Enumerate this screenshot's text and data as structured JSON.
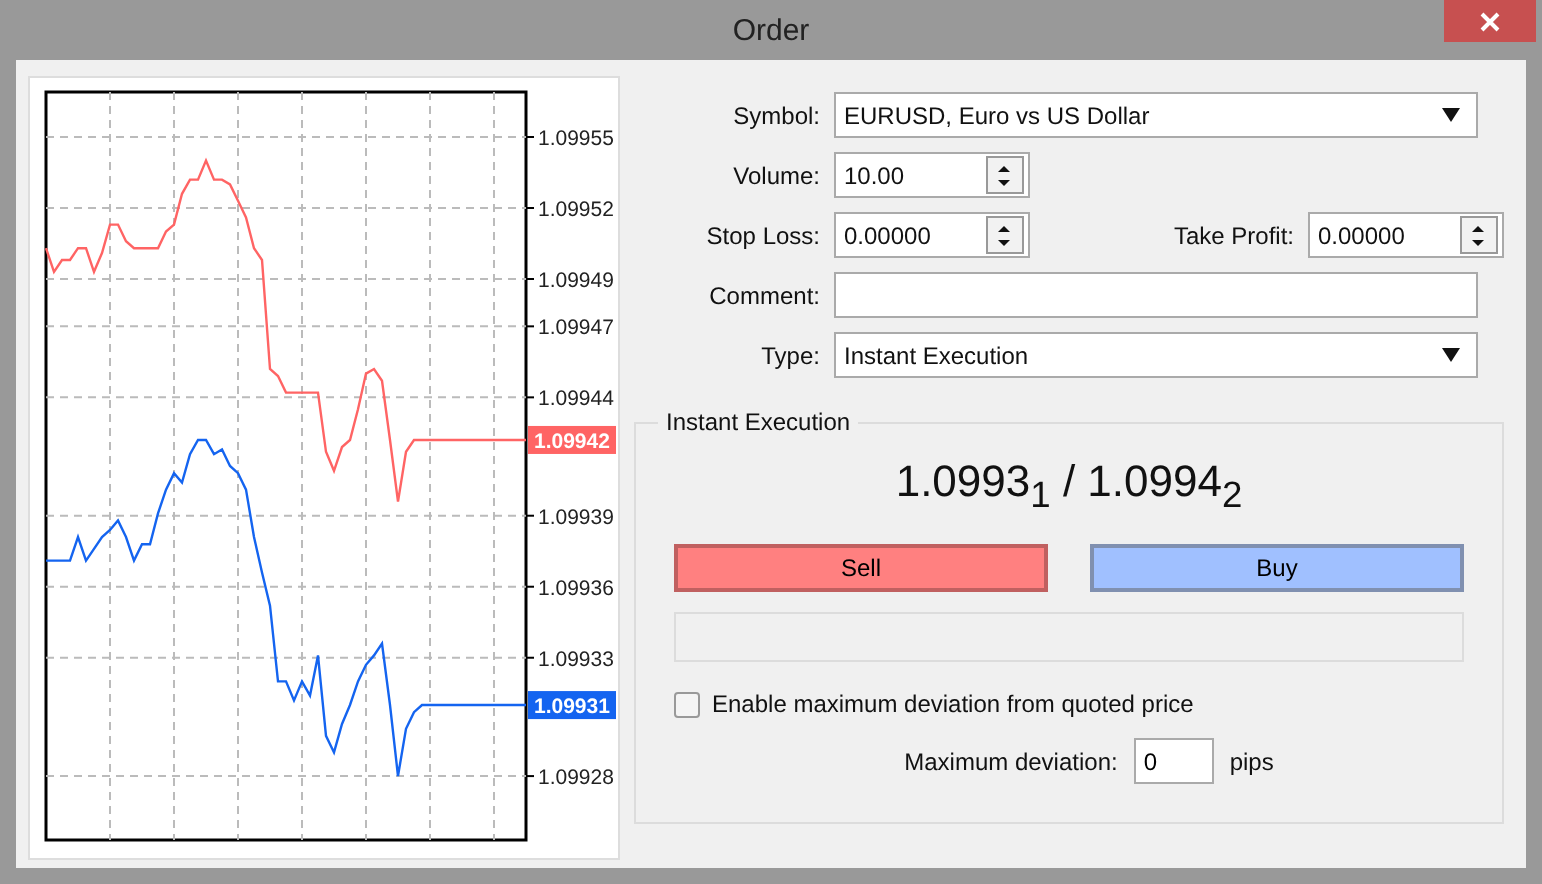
{
  "window": {
    "title": "Order"
  },
  "chart": {
    "chart_data": {
      "type": "line",
      "grid": true,
      "categories": [
        null,
        null,
        null,
        null,
        null,
        null,
        null,
        null,
        null,
        null,
        null,
        null,
        null,
        null,
        null,
        null,
        null,
        null,
        null,
        null,
        null,
        null,
        null,
        null,
        null,
        null,
        null,
        null,
        null,
        null,
        null,
        null,
        null,
        null,
        null,
        null,
        null,
        null,
        null,
        null,
        null,
        null,
        null,
        null,
        null,
        null,
        null,
        null,
        null,
        null,
        null,
        null,
        null,
        null,
        null,
        null,
        null,
        null,
        null,
        null,
        null
      ],
      "ylim": [
        1.099253,
        1.099569
      ],
      "yticks": [
        1.09955,
        1.09952,
        1.09949,
        1.09947,
        1.09944,
        1.09939,
        1.09936,
        1.09933,
        1.09928
      ],
      "series": [
        {
          "color": "#ff6464",
          "values": [
            1.099503,
            1.099493,
            1.099498,
            1.099498,
            1.099503,
            1.099503,
            1.099493,
            1.099501,
            1.099513,
            1.099513,
            1.099506,
            1.099503,
            1.099503,
            1.099503,
            1.099503,
            1.09951,
            1.099513,
            1.099526,
            1.099532,
            1.099532,
            1.09954,
            1.099532,
            1.099532,
            1.09953,
            1.099523,
            1.099516,
            1.099503,
            1.099498,
            1.099452,
            1.099449,
            1.099442,
            1.099442,
            1.099442,
            1.099442,
            1.099442,
            1.099417,
            1.099409,
            1.099419,
            1.099422,
            1.099435,
            1.09945,
            1.099452,
            1.099447,
            1.099422,
            1.099396,
            1.099417,
            1.099422,
            1.099422,
            1.099422,
            1.099422,
            1.099422,
            1.099422,
            1.099422,
            1.099422,
            1.099422,
            1.099422,
            1.099422,
            1.099422,
            1.099422,
            1.099422,
            1.099422
          ]
        },
        {
          "color": "#1464f0",
          "values": [
            1.099371,
            1.099371,
            1.099371,
            1.099371,
            1.099381,
            1.099371,
            1.099376,
            1.099381,
            1.099384,
            1.099388,
            1.099381,
            1.099371,
            1.099378,
            1.099378,
            1.099391,
            1.099401,
            1.099408,
            1.099404,
            1.099416,
            1.099422,
            1.099422,
            1.099416,
            1.099418,
            1.099411,
            1.099408,
            1.099401,
            1.099381,
            1.099366,
            1.099352,
            1.09932,
            1.09932,
            1.099312,
            1.09932,
            1.099314,
            1.099331,
            1.099297,
            1.09929,
            1.099302,
            1.09931,
            1.09932,
            1.099327,
            1.099331,
            1.099336,
            1.09931,
            1.09928,
            1.0993,
            1.099307,
            1.09931,
            1.09931,
            1.09931,
            1.09931,
            1.09931,
            1.09931,
            1.09931,
            1.09931,
            1.09931,
            1.09931,
            1.09931,
            1.09931,
            1.09931,
            1.09931
          ]
        }
      ]
    },
    "price_badges": [
      {
        "label": "1.09942",
        "color": "#ff6464"
      },
      {
        "label": "1.09931",
        "color": "#1464f0"
      }
    ]
  },
  "form": {
    "symbol": {
      "label": "Symbol:",
      "value": "EURUSD, Euro vs US Dollar"
    },
    "volume": {
      "label": "Volume:",
      "value": "10.00"
    },
    "stop_loss": {
      "label": "Stop Loss:",
      "value": "0.00000"
    },
    "take_profit": {
      "label": "Take Profit:",
      "value": "0.00000"
    },
    "comment": {
      "label": "Comment:"
    },
    "type": {
      "label": "Type:",
      "value": "Instant Execution"
    }
  },
  "instant_execution": {
    "title": "Instant Execution",
    "price": "1.0993$_{1}$ / 1.0994$_{2}$",
    "sell_button": "Sell",
    "buy_button": "Buy",
    "deviation_enabled": {
      "label": "Enable maximum deviation from quoted price",
      "checked": false
    },
    "max_deviation": {
      "label": "Maximum deviation:",
      "value": "0",
      "unit": "pips"
    }
  }
}
